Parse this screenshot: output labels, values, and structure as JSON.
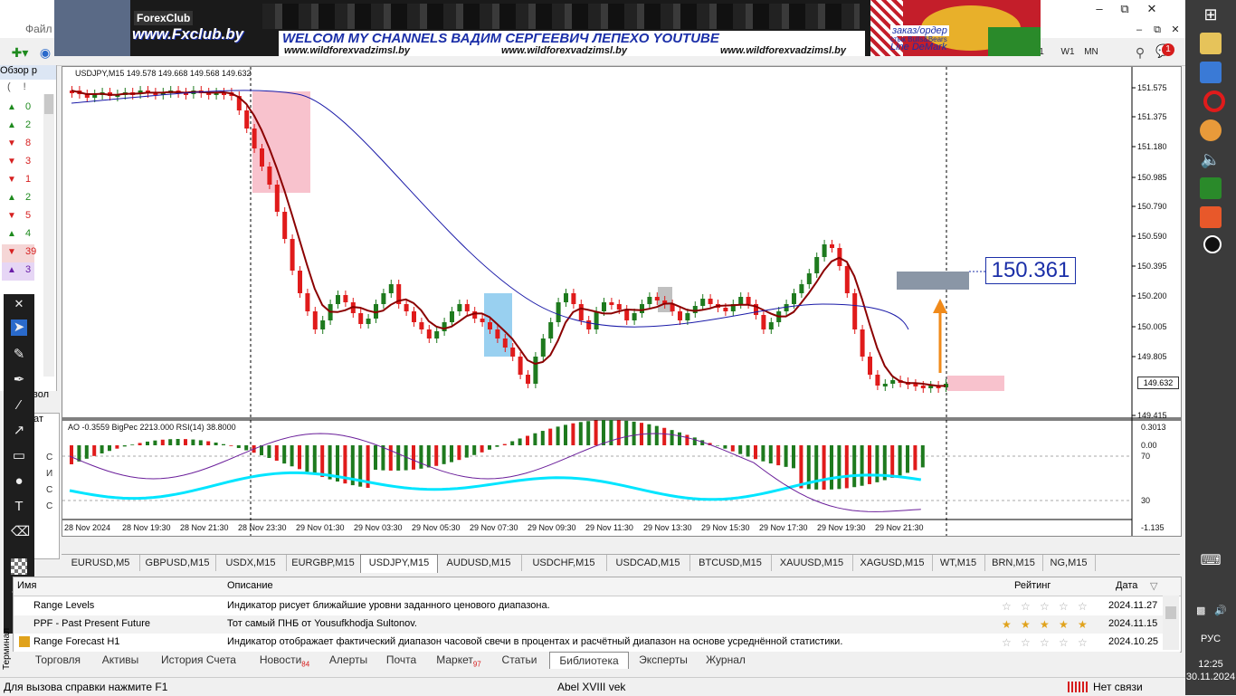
{
  "menu": {
    "file": "Файл"
  },
  "toolbar": {
    "w1": "W1",
    "mn": "MN",
    "tf_partial": "1"
  },
  "banner": {
    "logo": "ForexClub",
    "fxclub": "www.Fxclub.by",
    "headline": "WELCOM MY CHANNELS ВАДИМ СЕРГЕЕВИЧ ЛЕПЕХО YOUTUBE",
    "url1": "www.wildforexvadzimsl.by",
    "url2": "www.wildforexvadzimsl.by",
    "url3": "www.wildforexvadzimsl.by",
    "zakaz": "заказ/ордер",
    "stik": "стык Bulls&Bears",
    "linedemark": "Line DeMark"
  },
  "market_watch": {
    "title": "Обзор р",
    "header": "!",
    "rows": [
      {
        "dir": "up",
        "value": "0",
        "color": "#1e8a1e"
      },
      {
        "dir": "up",
        "value": "2",
        "color": "#1e8a1e"
      },
      {
        "dir": "down",
        "value": "8",
        "color": "#d62020"
      },
      {
        "dir": "down",
        "value": "3",
        "color": "#d62020"
      },
      {
        "dir": "down",
        "value": "1",
        "color": "#d62020"
      },
      {
        "dir": "up",
        "value": "2",
        "color": "#1e8a1e"
      },
      {
        "dir": "down",
        "value": "5",
        "color": "#d62020"
      },
      {
        "dir": "up",
        "value": "4",
        "color": "#1e8a1e"
      },
      {
        "dir": "down",
        "value": "39",
        "color": "#d62020"
      },
      {
        "dir": "up",
        "value": "3",
        "color": "#6a1ea8"
      }
    ],
    "partial_label": "вол",
    "nav_partial": "ат"
  },
  "chart": {
    "symbol_title": "USDJPY,M15  149.578 149.668 149.568 149.632",
    "indicator_title": "AO -0.3559  BigPec 2213.000  RSI(14) 38.8000",
    "price_labels": [
      "151.575",
      "151.375",
      "151.180",
      "150.985",
      "150.790",
      "150.590",
      "150.395",
      "150.200",
      "150.005",
      "149.805",
      "149.632",
      "149.415"
    ],
    "current_price": "149.632",
    "callout_price": "150.361",
    "indicator_labels": [
      "0.3013",
      "0.00",
      "70",
      "30",
      "-1.135"
    ],
    "time_labels": [
      "28 Nov 2024",
      "28 Nov 19:30",
      "28 Nov 21:30",
      "28 Nov 23:30",
      "29 Nov 01:30",
      "29 Nov 03:30",
      "29 Nov 05:30",
      "29 Nov 07:30",
      "29 Nov 09:30",
      "29 Nov 11:30",
      "29 Nov 13:30",
      "29 Nov 15:30",
      "29 Nov 17:30",
      "29 Nov 19:30",
      "29 Nov 21:30"
    ],
    "colors": {
      "bull": "#1e7a1e",
      "bear": "#e01b1b",
      "ma_fast": "#8b0000",
      "ma_slow": "#1a1aa8",
      "rsi": "#00e5ff",
      "ao_line": "#6a1e9a"
    }
  },
  "symbol_tabs": [
    "EURUSD,M5",
    "GBPUSD,M15",
    "USDX,M15",
    "EURGBP,M15",
    "USDJPY,M15",
    "AUDUSD,M15",
    "USDCHF,M15",
    "USDCAD,M15",
    "BTCUSD,M15",
    "XAUUSD,M15",
    "XAGUSD,M15",
    "WT,M15",
    "BRN,M15",
    "NG,M15"
  ],
  "active_symbol_tab": "USDJPY,M15",
  "terminal": {
    "col_name": "Имя",
    "col_desc": "Описание",
    "col_rating": "Рейтинг",
    "col_date": "Дата",
    "rows": [
      {
        "name": "Range Levels",
        "desc": "Индикатор рисует ближайшие уровни заданного ценового диапазона.",
        "stars": 0,
        "date": "2024.11.27"
      },
      {
        "name": "PPF - Past Present Future",
        "desc": "Тот самый ПНБ от Yousufkhodja Sultonov.",
        "stars": 5,
        "date": "2024.11.15"
      },
      {
        "name": "Range Forecast H1",
        "desc": "Индикатор отображает фактический диапазон часовой свечи в процентах и расчётный диапазон на основе усреднённой статистики.",
        "stars": 0,
        "date": "2024.10.25"
      }
    ],
    "tabs": [
      {
        "label": "Торговля"
      },
      {
        "label": "Активы"
      },
      {
        "label": "История Счета"
      },
      {
        "label": "Новости",
        "badge": "84"
      },
      {
        "label": "Алерты"
      },
      {
        "label": "Почта"
      },
      {
        "label": "Маркет",
        "badge": "97"
      },
      {
        "label": "Статьи"
      },
      {
        "label": "Библиотека",
        "active": true
      },
      {
        "label": "Эксперты"
      },
      {
        "label": "Журнал"
      }
    ],
    "side_label": "Терминал"
  },
  "status": {
    "help": "Для вызова справки нажмите F1",
    "profile": "Abel XVIII vek",
    "connection": "Нет связи"
  },
  "taskbar": {
    "lang": "РУС",
    "time": "12:25",
    "date": "30.11.2024"
  }
}
